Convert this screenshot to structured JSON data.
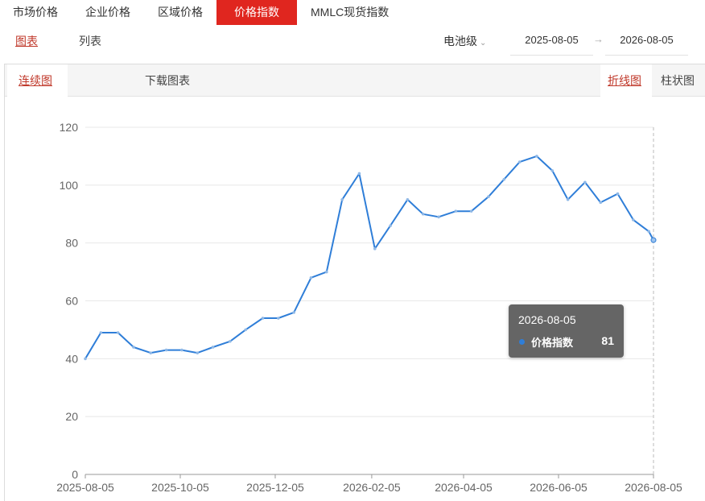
{
  "top_tabs": [
    {
      "label": "市场价格",
      "active": false
    },
    {
      "label": "企业价格",
      "active": false
    },
    {
      "label": "区域价格",
      "active": false
    },
    {
      "label": "价格指数",
      "active": true
    },
    {
      "label": "MMLC现货指数",
      "active": false
    }
  ],
  "view": {
    "chart_label": "图表",
    "list_label": "列表"
  },
  "filter": {
    "grade": "电池级",
    "start_date": "2025-08-05",
    "end_date": "2026-08-05"
  },
  "toolbar": {
    "continuous_label": "连续图",
    "download_label": "下载图表",
    "line_label": "折线图",
    "bar_label": "柱状图"
  },
  "colors": {
    "series": "#2f7ed8",
    "active_tab": "#e0261f",
    "active_link": "#c0392b"
  },
  "tooltip": {
    "date": "2026-08-05",
    "series_name": "价格指数",
    "value": "81"
  },
  "chart_data": {
    "type": "line",
    "title": "",
    "xlabel": "",
    "ylabel": "",
    "ylim": [
      0,
      120
    ],
    "yticks": [
      0,
      20,
      40,
      60,
      80,
      100,
      120
    ],
    "xlim": [
      "2025-08-05",
      "2026-08-05"
    ],
    "xticks": [
      "2025-08-05",
      "2025-10-05",
      "2025-12-05",
      "2026-02-05",
      "2026-04-05",
      "2026-06-05",
      "2026-08-05"
    ],
    "grid": "horizontal",
    "series": [
      {
        "name": "价格指数",
        "points": [
          [
            "2025-08-05",
            40
          ],
          [
            "2025-08-15",
            49
          ],
          [
            "2025-08-26",
            49
          ],
          [
            "2025-09-05",
            44
          ],
          [
            "2025-09-16",
            42
          ],
          [
            "2025-09-26",
            43
          ],
          [
            "2025-10-06",
            43
          ],
          [
            "2025-10-16",
            42
          ],
          [
            "2025-10-26",
            44
          ],
          [
            "2025-11-06",
            46
          ],
          [
            "2025-11-16",
            50
          ],
          [
            "2025-11-27",
            54
          ],
          [
            "2025-12-07",
            54
          ],
          [
            "2025-12-17",
            56
          ],
          [
            "2025-12-28",
            68
          ],
          [
            "2026-01-07",
            70
          ],
          [
            "2026-01-17",
            95
          ],
          [
            "2026-01-28",
            104
          ],
          [
            "2026-02-07",
            78
          ],
          [
            "2026-02-17",
            86
          ],
          [
            "2026-02-28",
            95
          ],
          [
            "2026-03-10",
            90
          ],
          [
            "2026-03-20",
            89
          ],
          [
            "2026-03-31",
            91
          ],
          [
            "2026-04-10",
            91
          ],
          [
            "2026-04-21",
            96
          ],
          [
            "2026-05-01",
            102
          ],
          [
            "2026-05-11",
            108
          ],
          [
            "2026-05-22",
            110
          ],
          [
            "2026-06-01",
            105
          ],
          [
            "2026-06-11",
            95
          ],
          [
            "2026-06-22",
            101
          ],
          [
            "2026-07-02",
            94
          ],
          [
            "2026-07-13",
            97
          ],
          [
            "2026-07-23",
            88
          ],
          [
            "2026-08-02",
            84
          ],
          [
            "2026-08-05",
            81
          ]
        ]
      }
    ]
  }
}
